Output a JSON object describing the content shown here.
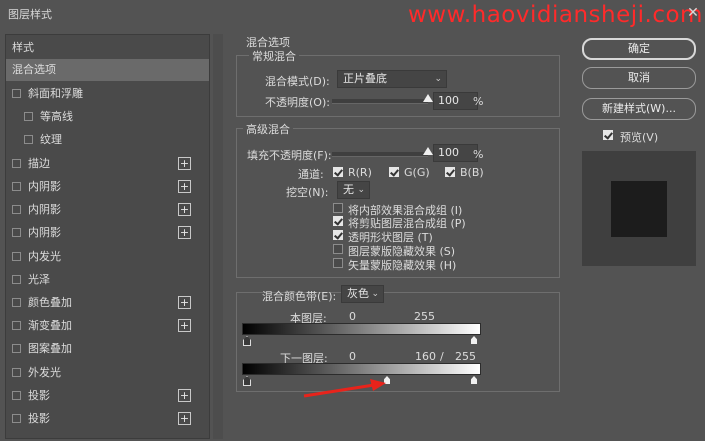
{
  "window": {
    "title": "图层样式",
    "watermark": "www.haovidiansheji.com",
    "close_glyph": "✕"
  },
  "left_panel": {
    "items": [
      {
        "label": "样式",
        "checkbox": false,
        "plus": false,
        "selected": false,
        "indent": 0
      },
      {
        "label": "混合选项",
        "checkbox": false,
        "plus": false,
        "selected": true,
        "indent": 0
      },
      {
        "label": "斜面和浮雕",
        "checkbox": true,
        "plus": false,
        "selected": false,
        "indent": 0
      },
      {
        "label": "等高线",
        "checkbox": true,
        "plus": false,
        "selected": false,
        "indent": 1
      },
      {
        "label": "纹理",
        "checkbox": true,
        "plus": false,
        "selected": false,
        "indent": 1
      },
      {
        "label": "描边",
        "checkbox": true,
        "plus": true,
        "selected": false,
        "indent": 0
      },
      {
        "label": "内阴影",
        "checkbox": true,
        "plus": true,
        "selected": false,
        "indent": 0
      },
      {
        "label": "内阴影",
        "checkbox": true,
        "plus": true,
        "selected": false,
        "indent": 0
      },
      {
        "label": "内阴影",
        "checkbox": true,
        "plus": true,
        "selected": false,
        "indent": 0
      },
      {
        "label": "内发光",
        "checkbox": true,
        "plus": false,
        "selected": false,
        "indent": 0
      },
      {
        "label": "光泽",
        "checkbox": true,
        "plus": false,
        "selected": false,
        "indent": 0
      },
      {
        "label": "颜色叠加",
        "checkbox": true,
        "plus": true,
        "selected": false,
        "indent": 0
      },
      {
        "label": "渐变叠加",
        "checkbox": true,
        "plus": true,
        "selected": false,
        "indent": 0
      },
      {
        "label": "图案叠加",
        "checkbox": true,
        "plus": false,
        "selected": false,
        "indent": 0
      },
      {
        "label": "外发光",
        "checkbox": true,
        "plus": false,
        "selected": false,
        "indent": 0
      },
      {
        "label": "投影",
        "checkbox": true,
        "plus": true,
        "selected": false,
        "indent": 0
      },
      {
        "label": "投影",
        "checkbox": true,
        "plus": true,
        "selected": false,
        "indent": 0
      }
    ],
    "plus_glyph": "+"
  },
  "blend": {
    "section_title": "混合选项",
    "general": {
      "legend": "常规混合",
      "mode_label": "混合模式(D):",
      "mode_value": "正片叠底",
      "opacity_label": "不透明度(O):",
      "opacity_value": "100",
      "opacity_fraction": 1.0,
      "percent": "%"
    },
    "advanced": {
      "legend": "高级混合",
      "fill_label": "填充不透明度(F):",
      "fill_value": "100",
      "fill_fraction": 1.0,
      "percent": "%",
      "channels_label": "通道:",
      "channel_r": "R(R)",
      "channel_g": "G(G)",
      "channel_b": "B(B)",
      "knockout_label": "挖空(N):",
      "knockout_value": "无",
      "options": [
        {
          "label": "将内部效果混合成组 (I)",
          "checked": false
        },
        {
          "label": "将剪贴图层混合成组 (P)",
          "checked": true
        },
        {
          "label": "透明形状图层 (T)",
          "checked": true
        },
        {
          "label": "图层蒙版隐藏效果 (S)",
          "checked": false
        },
        {
          "label": "矢量蒙版隐藏效果 (H)",
          "checked": false
        }
      ]
    },
    "blend_if": {
      "label": "混合颜色带(E):",
      "value": "灰色",
      "this_layer_label": "本图层:",
      "this_layer_left": "0",
      "this_layer_right": "255",
      "under_layer_label": "下一图层:",
      "under_layer_left": "0",
      "under_layer_split": "160",
      "under_layer_sep": "/",
      "under_layer_right": "255"
    }
  },
  "right": {
    "ok_label": "确定",
    "cancel_label": "取消",
    "new_style_label": "新建样式(W)...",
    "preview_label": "预览(V)"
  },
  "colors": {
    "accent_arrow": "#e8231b",
    "watermark": "#ff2a2a"
  }
}
